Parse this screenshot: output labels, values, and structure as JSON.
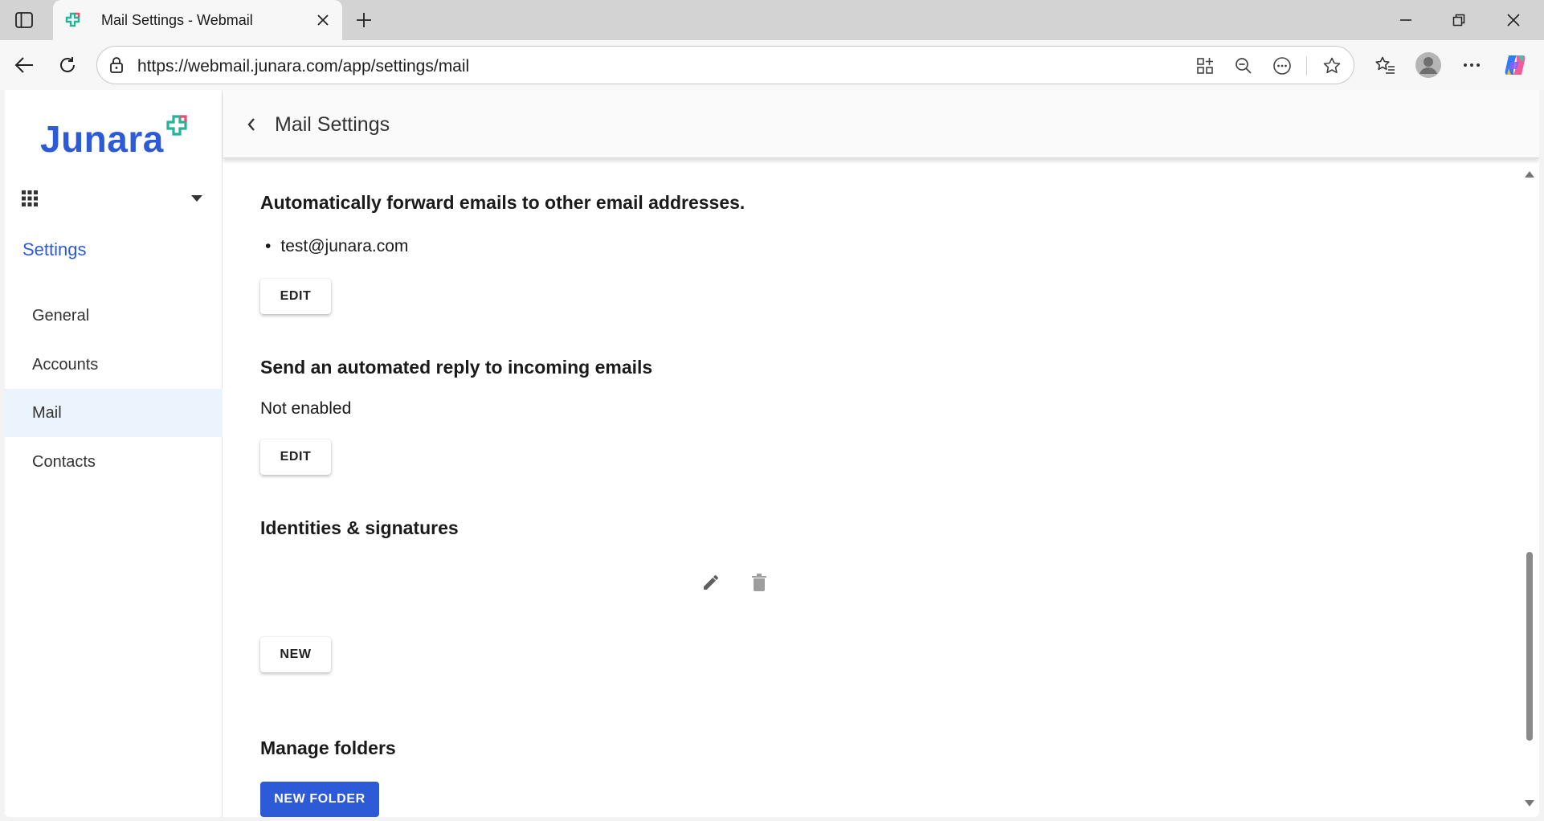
{
  "browser": {
    "tab_title": "Mail Settings - Webmail",
    "url": "https://webmail.junara.com/app/settings/mail",
    "accent_color": "#2d5bd8"
  },
  "sidebar": {
    "logo_text": "Junara",
    "heading": "Settings",
    "items": [
      {
        "label": "General",
        "active": false
      },
      {
        "label": "Accounts",
        "active": false
      },
      {
        "label": "Mail",
        "active": true
      },
      {
        "label": "Contacts",
        "active": false
      }
    ]
  },
  "header": {
    "title": "Mail Settings"
  },
  "forwarding": {
    "title": "Automatically forward emails to other email addresses.",
    "addresses": [
      "test@junara.com"
    ],
    "edit_label": "EDIT"
  },
  "auto_reply": {
    "title": "Send an automated reply to incoming emails",
    "status": "Not enabled",
    "edit_label": "EDIT"
  },
  "identities": {
    "title": "Identities & signatures",
    "new_label": "NEW"
  },
  "folders": {
    "title": "Manage folders",
    "new_folder_label": "NEW FOLDER"
  }
}
